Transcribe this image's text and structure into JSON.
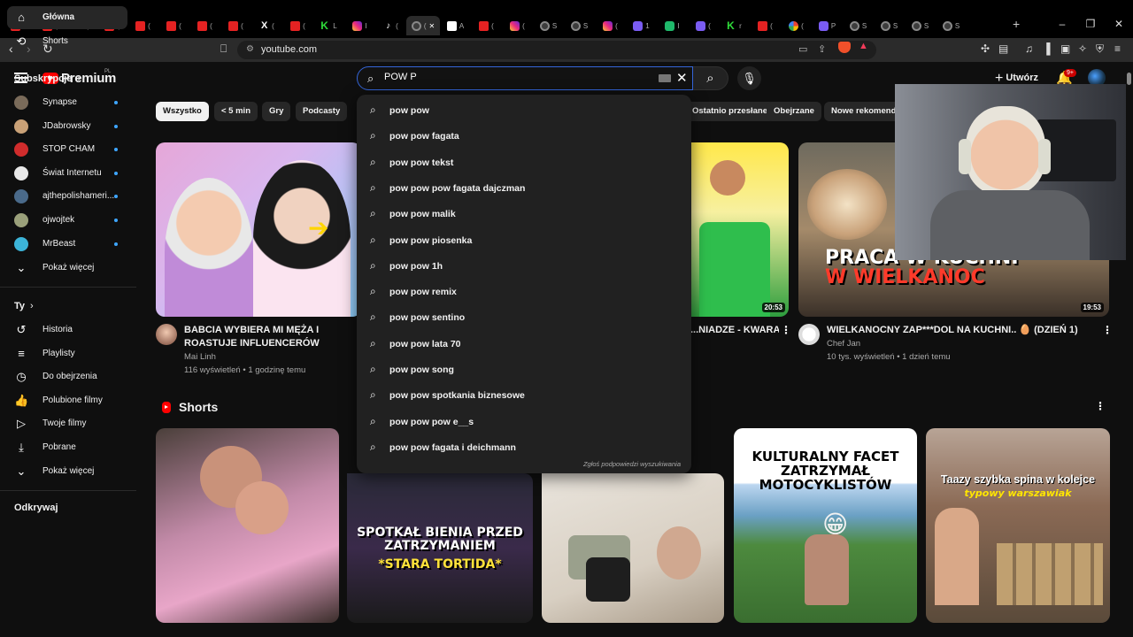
{
  "browser": {
    "tabs": [
      {
        "icon": "youtube-icon",
        "label": "B"
      },
      {
        "icon": "youtube-icon",
        "label": "("
      },
      {
        "icon": "tiktok-icon",
        "label": "("
      },
      {
        "icon": "youtube-icon",
        "label": "("
      },
      {
        "icon": "youtube-icon",
        "label": "("
      },
      {
        "icon": "youtube-icon",
        "label": "("
      },
      {
        "icon": "youtube-icon",
        "label": "("
      },
      {
        "icon": "youtube-icon",
        "label": "("
      },
      {
        "icon": "x-icon",
        "label": "("
      },
      {
        "icon": "youtube-icon",
        "label": "("
      },
      {
        "icon": "kick-icon",
        "label": "L"
      },
      {
        "icon": "instagram-icon",
        "label": "I"
      },
      {
        "icon": "tiktok-icon",
        "label": "("
      },
      {
        "icon": "loading-icon",
        "label": "(",
        "active": true
      },
      {
        "icon": "docs-icon",
        "label": "A"
      },
      {
        "icon": "youtube-icon",
        "label": "("
      },
      {
        "icon": "instagram-icon",
        "label": "("
      },
      {
        "icon": "globe-icon",
        "label": "S"
      },
      {
        "icon": "globe-icon",
        "label": "S"
      },
      {
        "icon": "instagram-icon",
        "label": "("
      },
      {
        "icon": "app-icon",
        "label": "1"
      },
      {
        "icon": "sheets-icon",
        "label": "I"
      },
      {
        "icon": "app-icon",
        "label": "("
      },
      {
        "icon": "kick-icon",
        "label": "r"
      },
      {
        "icon": "youtube-icon",
        "label": "("
      },
      {
        "icon": "google-icon",
        "label": "("
      },
      {
        "icon": "app-icon",
        "label": "P"
      },
      {
        "icon": "globe-icon",
        "label": "S"
      },
      {
        "icon": "globe-icon",
        "label": "S"
      },
      {
        "icon": "globe-icon",
        "label": "S"
      },
      {
        "icon": "globe-icon",
        "label": "S"
      }
    ],
    "new_tab": "+",
    "url": "youtube.com"
  },
  "youtube": {
    "logo_text": "Premium",
    "logo_region": "PL",
    "search_value": "POW P",
    "create_label": "Utwórz",
    "notif_count": "9+"
  },
  "sidebar": {
    "main": [
      {
        "icon": "home-icon",
        "glyph": "⌂",
        "label": "Główna",
        "active": true
      },
      {
        "icon": "shorts-icon",
        "glyph": "⟲",
        "label": "Shorts"
      }
    ],
    "subs_title": "Subskrypcje",
    "subs": [
      {
        "label": "Synapse",
        "color": "#7a6b5a"
      },
      {
        "label": "JDabrowsky",
        "color": "#c9a177"
      },
      {
        "label": "STOP CHAM",
        "color": "#d02c2c"
      },
      {
        "label": "Świat Internetu",
        "color": "#e8e8e8"
      },
      {
        "label": "ajthepolishameri...",
        "color": "#4a6a8a"
      },
      {
        "label": "ojwojtek",
        "color": "#9aa07a"
      },
      {
        "label": "MrBeast",
        "color": "#3cb4d8"
      }
    ],
    "subs_more": "Pokaż więcej",
    "you_title": "Ty",
    "you": [
      {
        "icon": "history-icon",
        "glyph": "↺",
        "label": "Historia"
      },
      {
        "icon": "playlists-icon",
        "glyph": "≡",
        "label": "Playlisty"
      },
      {
        "icon": "watch-later-icon",
        "glyph": "◷",
        "label": "Do obejrzenia"
      },
      {
        "icon": "liked-icon",
        "glyph": "👍",
        "label": "Polubione filmy"
      },
      {
        "icon": "your-videos-icon",
        "glyph": "▷",
        "label": "Twoje filmy"
      },
      {
        "icon": "download-icon",
        "glyph": "⤓",
        "label": "Pobrane"
      }
    ],
    "you_more": "Pokaż więcej",
    "explore_title": "Odkrywaj"
  },
  "chips": [
    "Wszystko",
    "< 5 min",
    "Gry",
    "Podcasty",
    "Ostatnio przesłane",
    "Obejrzane",
    "Nowe rekomenda"
  ],
  "videos": [
    {
      "title": "BABCIA WYBIERA MI MĘŻA I ROASTUJE INFLUENCERÓW",
      "channel": "Mai Linh",
      "stats": "116 wyświetleń • 1 godzinę temu"
    },
    {
      "title": "...NIADZE - KWARA",
      "duration": "20:53"
    },
    {
      "title": "WIELKANOCNY ZAP***DOL NA KUCHNI.. 🥚 (DZIEŃ 1)",
      "channel": "Chef Jan",
      "stats": "10 tys. wyświetleń • 1 dzień temu",
      "duration": "19:53",
      "thumb_text_1": "PRACA W KUCHNI",
      "thumb_text_2": "W WIELKANOC"
    }
  ],
  "shorts": {
    "title": "Shorts",
    "cards": [
      {
        "text": ""
      },
      {
        "text": "SPOTKAŁ BIENIA PRZED ZATRZYMANIEM",
        "subtext": "*STARA TORTIDA*"
      },
      {
        "text": ""
      },
      {
        "text": "KULTURALNY FACET ZATRZYMAŁ MOTOCYKLISTÓW"
      },
      {
        "text": "Taazy szybka spina w kolejce",
        "subtext": "typowy warszawiak"
      }
    ]
  },
  "suggestions": [
    "pow pow",
    "pow pow fagata",
    "pow pow tekst",
    "pow pow pow fagata dajczman",
    "pow pow malik",
    "pow pow piosenka",
    "pow pow 1h",
    "pow pow remix",
    "pow pow sentino",
    "pow pow lata 70",
    "pow pow song",
    "pow pow spotkania biznesowe",
    "pow pow pow e__s",
    "pow pow fagata i deichmann"
  ],
  "suggestions_report": "Zgłoś podpowiedzi wyszukiwania",
  "colors": {
    "accent": "#ff0000",
    "background": "#0f0f0f",
    "focus": "#3465d8",
    "live_dot": "#3ea6ff"
  }
}
